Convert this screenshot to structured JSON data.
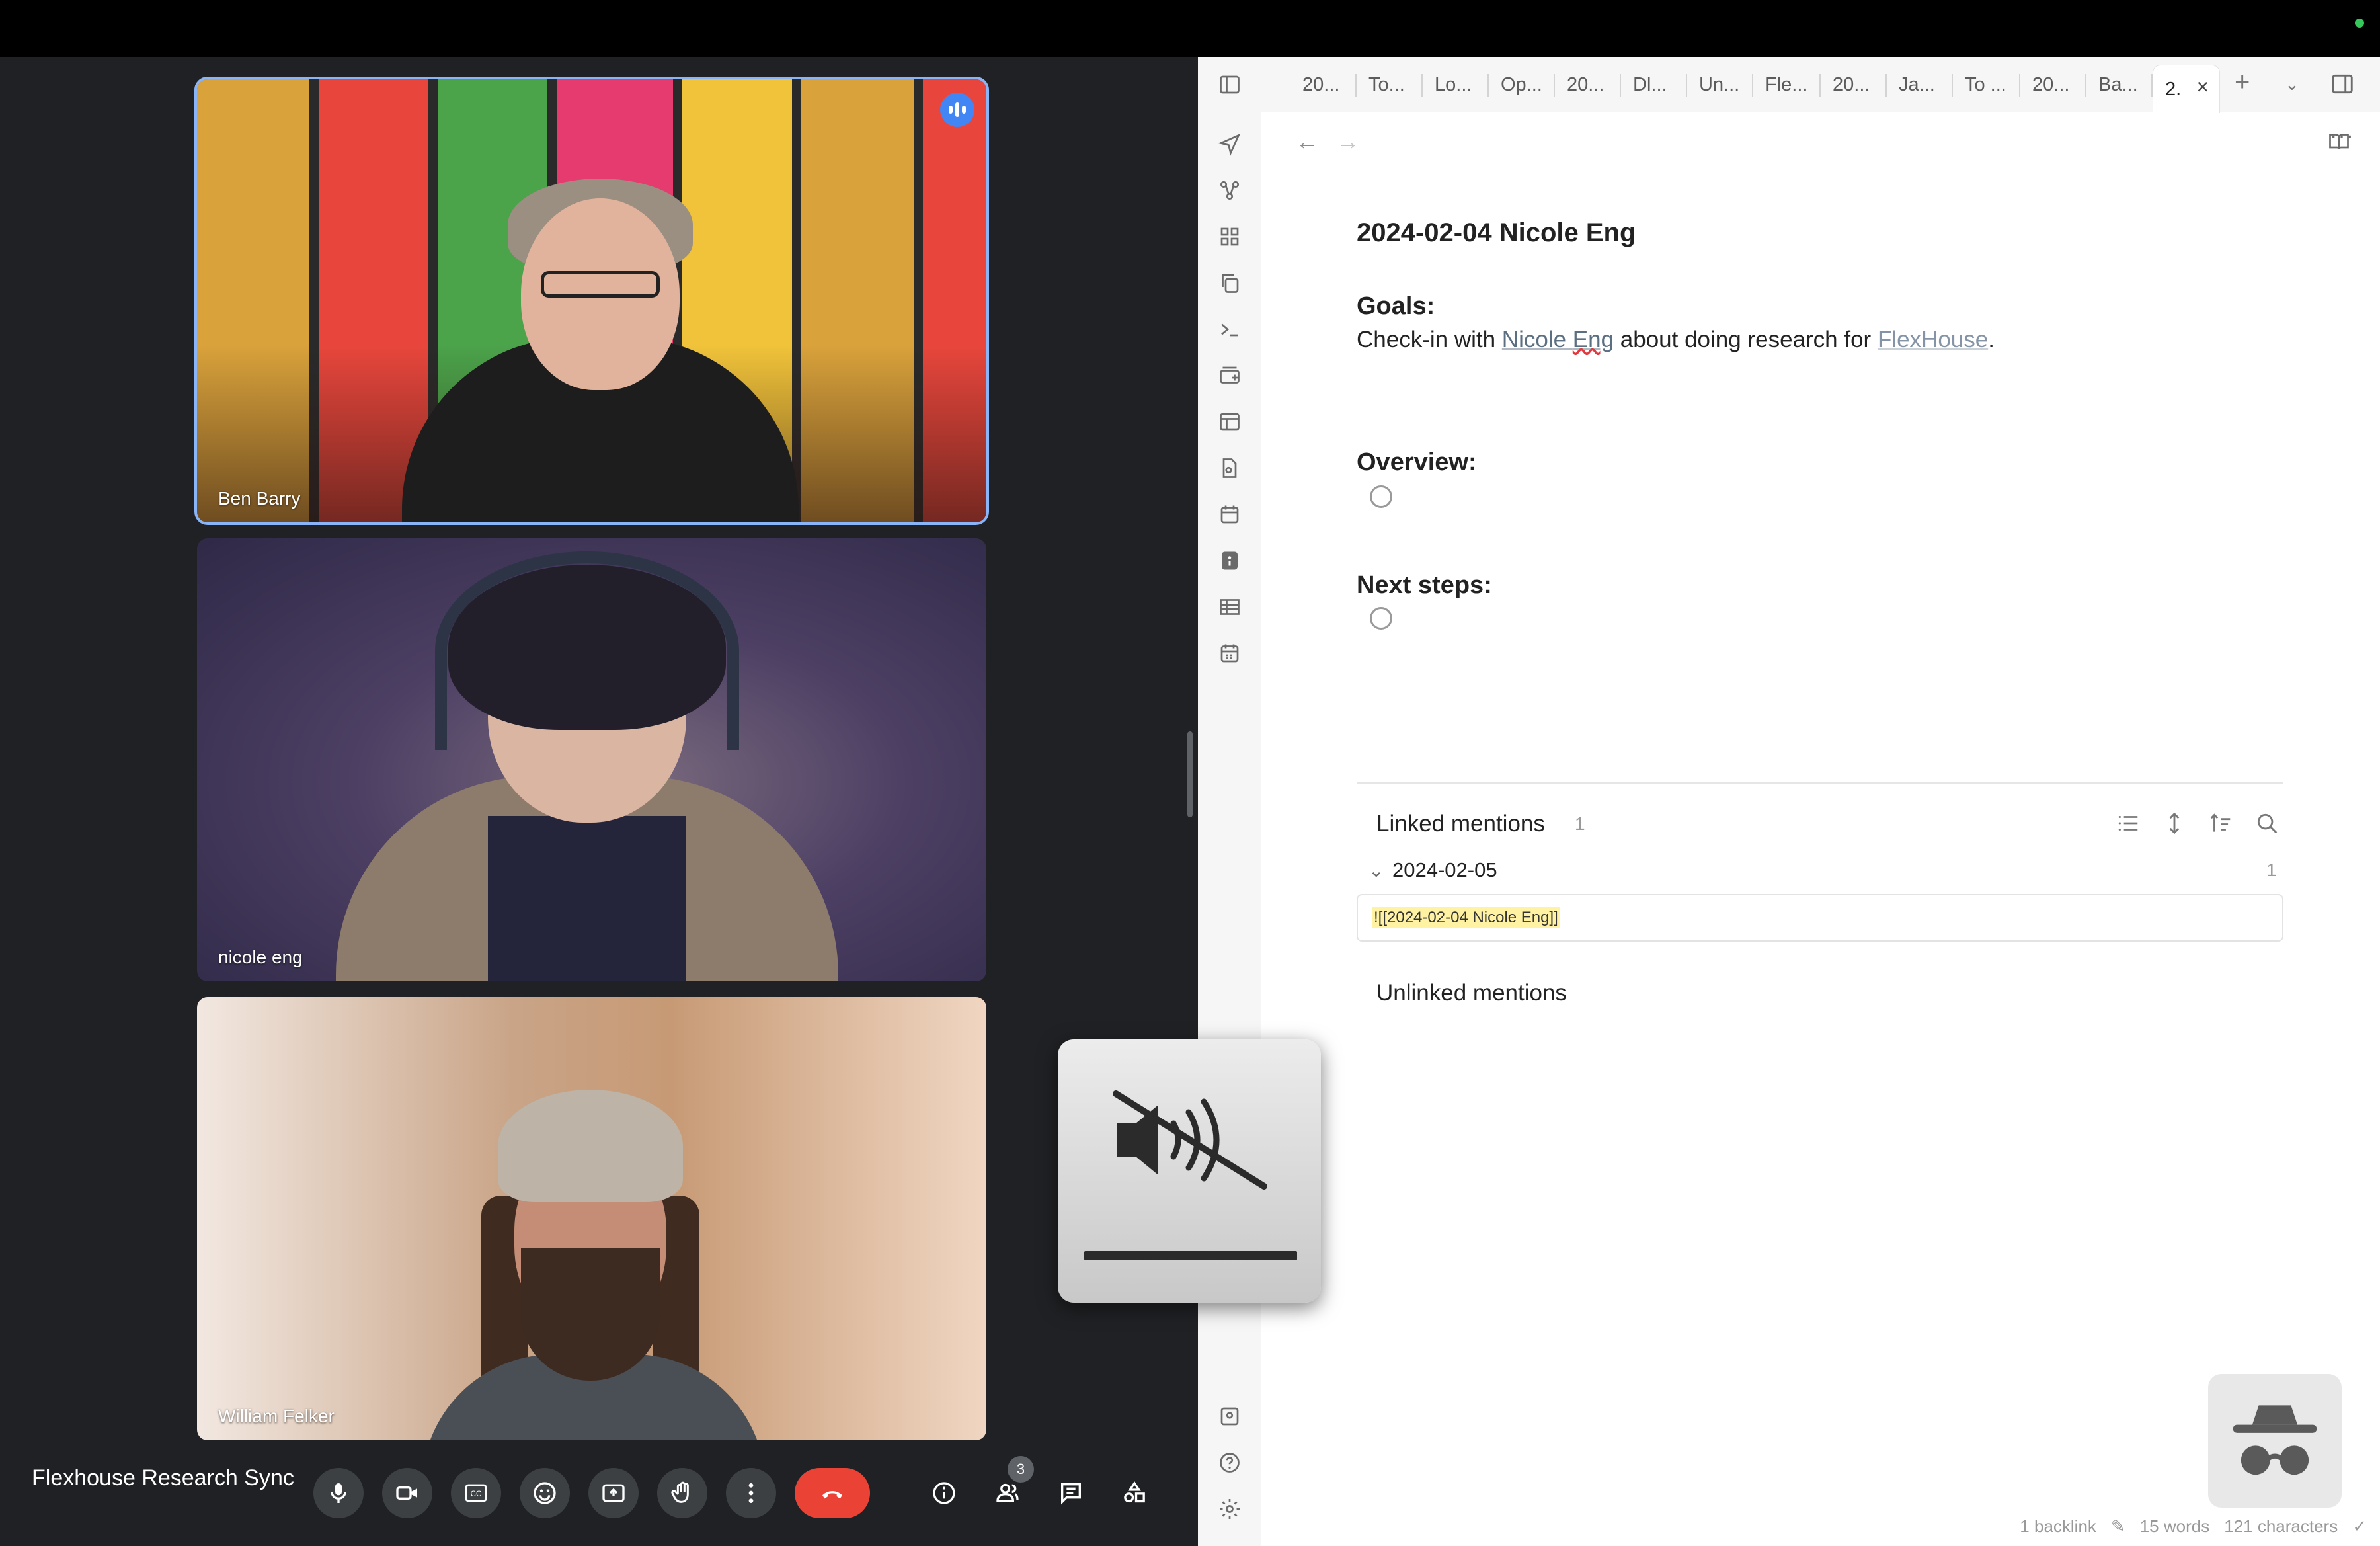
{
  "meet": {
    "meeting_title": "Flexhouse Research Sync",
    "participants": [
      {
        "name": "Ben Barry",
        "speaking": true
      },
      {
        "name": "nicole eng",
        "speaking": false
      },
      {
        "name": "William Felker",
        "speaking": false
      }
    ],
    "participant_count": "3",
    "controls": [
      "mic-icon",
      "camera-icon",
      "captions-icon",
      "emoji-icon",
      "present-icon",
      "raise-hand-icon",
      "more-options-icon",
      "end-call-icon",
      "info-icon",
      "people-icon",
      "chat-icon",
      "activities-icon"
    ],
    "end_call_color": "#ea4335",
    "active_speaker_color": "#8ab4f8"
  },
  "volume_hud": {
    "icon": "speaker-muted-icon",
    "level": 0
  },
  "obsidian": {
    "tabs": [
      "20...",
      "To...",
      "Lo...",
      "Op...",
      "20...",
      "Dl...",
      "Un...",
      "Fle...",
      "20...",
      "Ja...",
      "To ...",
      "20...",
      "Ba...",
      "2."
    ],
    "active_tab": "2.",
    "note": {
      "title": "2024-02-04 Nicole Eng",
      "goals_heading": "Goals:",
      "goals_prefix": "Check-in with ",
      "goals_link1_part1": "Nicole ",
      "goals_link1_part2": "Eng",
      "goals_middle": " about doing research for ",
      "goals_link2": "FlexHouse",
      "goals_suffix": ".",
      "overview_heading": "Overview:",
      "next_steps_heading": "Next steps:"
    },
    "backlinks": {
      "linked_title": "Linked mentions",
      "linked_count": "1",
      "file_name": "2024-02-05",
      "file_count": "1",
      "snippet": "![[2024-02-04 Nicole Eng]]",
      "unlinked_title": "Unlinked mentions"
    },
    "status_bar": {
      "backlinks": "1 backlink",
      "words": "15 words",
      "characters": "121 characters"
    }
  }
}
